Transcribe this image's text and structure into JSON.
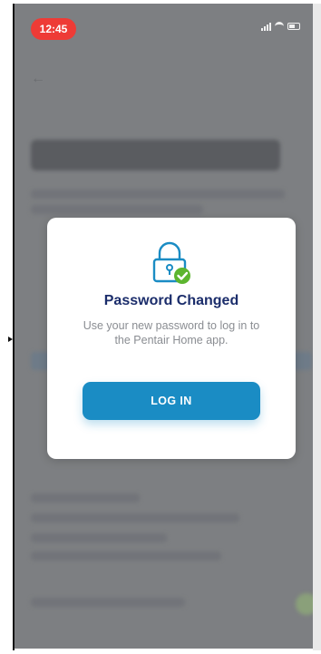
{
  "status_bar": {
    "time": "12:45",
    "time_badge_color": "#ee3b36",
    "icons": [
      "signal-icon",
      "wifi-icon",
      "battery-icon"
    ]
  },
  "background_screen": {
    "back_icon": "chevron-left-icon",
    "title_blurred": "Reset Password"
  },
  "dialog": {
    "icon": "lock-check-icon",
    "title": "Password Changed",
    "message": "Use your new password to log in to the Pentair Home app.",
    "button_label": "LOG IN",
    "colors": {
      "title": "#1b2d6b",
      "button": "#1a8cc4",
      "check_badge": "#5cb52f"
    }
  }
}
